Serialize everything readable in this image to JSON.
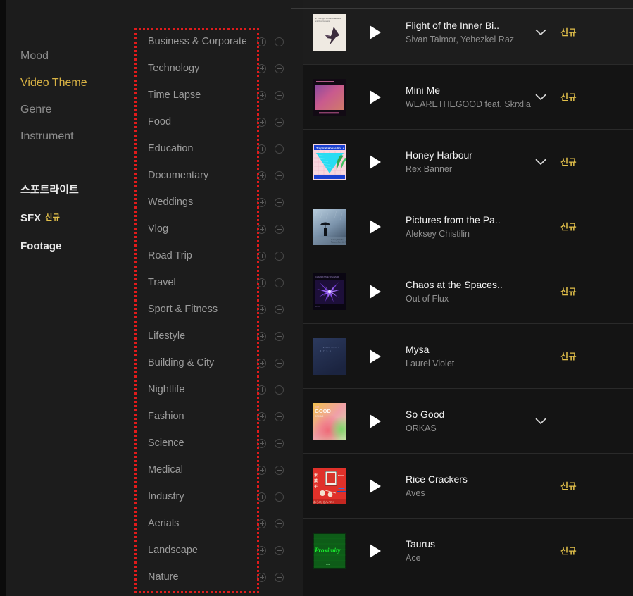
{
  "sidebar": {
    "filters": [
      {
        "label": "Mood",
        "active": false
      },
      {
        "label": "Video Theme",
        "active": true
      },
      {
        "label": "Genre",
        "active": false
      },
      {
        "label": "Instrument",
        "active": false
      }
    ],
    "sections": [
      {
        "label": "스포트라이트",
        "badge": ""
      },
      {
        "label": "SFX",
        "badge": "신규"
      },
      {
        "label": "Footage",
        "badge": ""
      }
    ]
  },
  "categories": {
    "add_icon": "plus-circle-icon",
    "remove_icon": "minus-circle-icon",
    "items": [
      "Business & Corporate",
      "Technology",
      "Time Lapse",
      "Food",
      "Education",
      "Documentary",
      "Weddings",
      "Vlog",
      "Road Trip",
      "Travel",
      "Sport & Fitness",
      "Lifestyle",
      "Building & City",
      "Nightlife",
      "Fashion",
      "Science",
      "Medical",
      "Industry",
      "Aerials",
      "Landscape",
      "Nature"
    ]
  },
  "tracks": {
    "play_icon": "play-icon",
    "expand_icon": "chevron-down-icon",
    "items": [
      {
        "title": "Flight of the Inner Bi..",
        "artist": "Sivan Talmor, Yehezkel Raz",
        "badge": "신규",
        "has_chevron": true,
        "hover": true,
        "art": "bird-cream"
      },
      {
        "title": "Mini Me",
        "artist": "WEARETHEGOOD feat. Skrxlla",
        "badge": "신규",
        "has_chevron": true,
        "hover": false,
        "art": "pink-gradient"
      },
      {
        "title": "Honey Harbour",
        "artist": "Rex Banner",
        "badge": "신규",
        "has_chevron": true,
        "hover": false,
        "art": "tropical-house"
      },
      {
        "title": "Pictures from the Pa..",
        "artist": "Aleksey Chistilin",
        "badge": "신규",
        "has_chevron": false,
        "hover": false,
        "art": "umbrella-blue"
      },
      {
        "title": "Chaos at the Spaces..",
        "artist": "Out of Flux",
        "badge": "신규",
        "has_chevron": false,
        "hover": false,
        "art": "purple-burst"
      },
      {
        "title": "Mysa",
        "artist": "Laurel Violet",
        "badge": "신규",
        "has_chevron": false,
        "hover": false,
        "art": "navy-plain"
      },
      {
        "title": "So Good",
        "artist": "ORKAS",
        "badge": "",
        "has_chevron": true,
        "hover": false,
        "art": "so-good"
      },
      {
        "title": "Rice Crackers",
        "artist": "Aves",
        "badge": "신규",
        "has_chevron": false,
        "hover": false,
        "art": "red-package"
      },
      {
        "title": "Taurus",
        "artist": "Ace",
        "badge": "신규",
        "has_chevron": false,
        "hover": false,
        "art": "green-proximity"
      }
    ]
  },
  "colors": {
    "accent": "#d8b244",
    "badge": "#e2c04a",
    "highlight_border": "#e01b1b",
    "panel_bg": "#1c1c1c",
    "list_bg": "#141414"
  }
}
